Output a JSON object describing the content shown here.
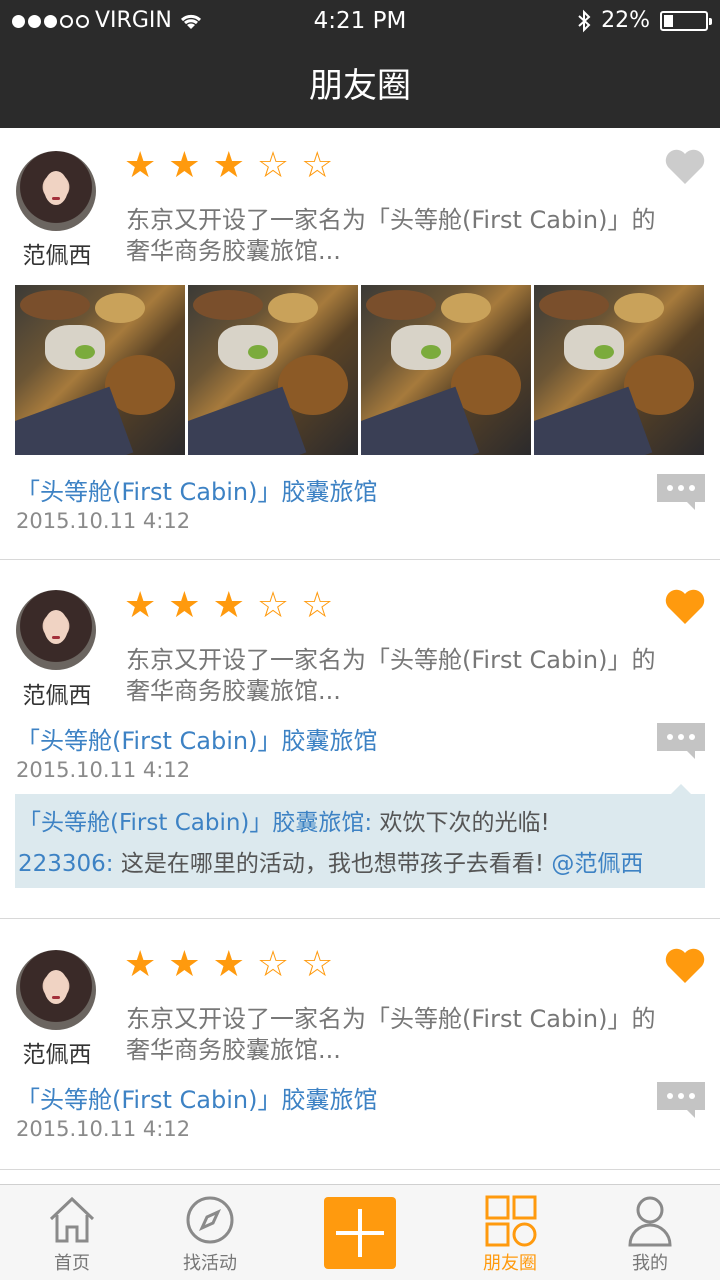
{
  "status_bar": {
    "carrier": "VIRGIN",
    "time": "4:21 PM",
    "battery": "22%",
    "battery_level": 0.22,
    "signal_bars": 3
  },
  "nav": {
    "title": "朋友圈"
  },
  "posts": [
    {
      "user": "范佩西",
      "rating": 3,
      "liked": false,
      "desc_line1": "东京又开设了一家名为「头等舱(First Cabin)」的",
      "desc_line2": "奢华商务胶囊旅馆...",
      "photo_count": 4,
      "link": "「头等舱(First Cabin)」胶囊旅馆",
      "date": "2015.10.11   4:12"
    },
    {
      "user": "范佩西",
      "rating": 3,
      "liked": true,
      "desc_line1": "东京又开设了一家名为「头等舱(First Cabin)」的",
      "desc_line2": "奢华商务胶囊旅馆...",
      "link": "「头等舱(First Cabin)」胶囊旅馆",
      "date": "2015.10.11   4:12",
      "comments": [
        {
          "who": "「头等舱(First Cabin)」胶囊旅馆:",
          "text": "欢饮下次的光临!",
          "mention": ""
        },
        {
          "who": "223306:",
          "text": "这是在哪里的活动，我也想带孩子去看看!",
          "mention": "@范佩西"
        }
      ]
    },
    {
      "user": "范佩西",
      "rating": 3,
      "liked": true,
      "desc_line1": "东京又开设了一家名为「头等舱(First Cabin)」的",
      "desc_line2": "奢华商务胶囊旅馆...",
      "link": "「头等舱(First Cabin)」胶囊旅馆",
      "date": "2015.10.11   4:12"
    }
  ],
  "tabs": [
    {
      "label": "首页",
      "icon": "home-icon"
    },
    {
      "label": "找活动",
      "icon": "compass-icon"
    },
    {
      "label": "",
      "icon": "plus-icon"
    },
    {
      "label": "朋友圈",
      "icon": "grid-icon",
      "active": true
    },
    {
      "label": "我的",
      "icon": "person-icon"
    }
  ],
  "colors": {
    "accent": "#ff9a0e",
    "link": "#3d82c4",
    "header_bg": "#2b2b2b",
    "comment_bg": "#dce9ee"
  }
}
